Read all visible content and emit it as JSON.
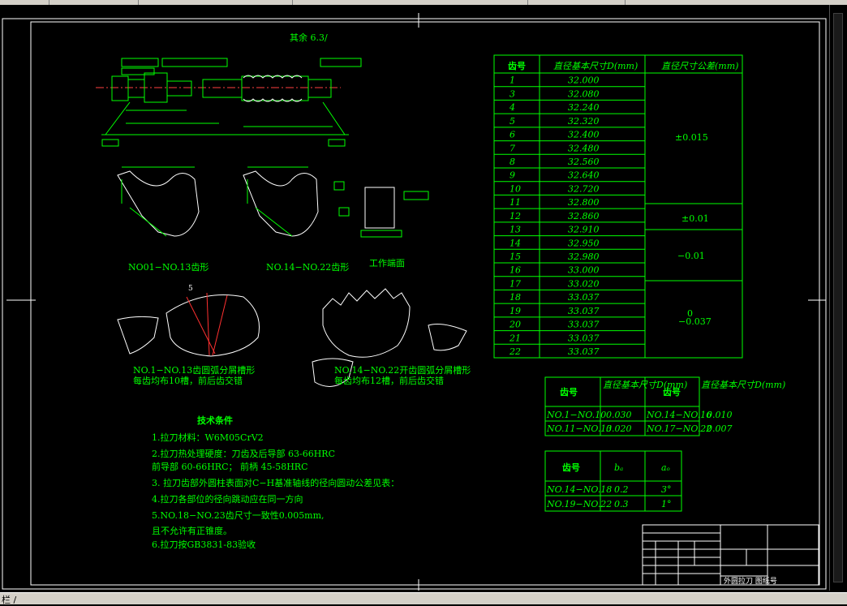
{
  "app": {
    "status_text": "栏 /"
  },
  "drawing": {
    "surface_mark": "其余 6.3/",
    "table1": {
      "headers": [
        "齿号",
        "直径基本尺寸D(mm)",
        "直径尺寸公差(mm)"
      ],
      "rows": [
        [
          "1",
          "32.000"
        ],
        [
          "3",
          "32.080"
        ],
        [
          "4",
          "32.240"
        ],
        [
          "5",
          "32.320"
        ],
        [
          "6",
          "32.400"
        ],
        [
          "7",
          "32.480"
        ],
        [
          "8",
          "32.560"
        ],
        [
          "9",
          "32.640"
        ],
        [
          "10",
          "32.720"
        ],
        [
          "11",
          "32.800"
        ],
        [
          "12",
          "32.860"
        ],
        [
          "13",
          "32.910"
        ],
        [
          "14",
          "32.950"
        ],
        [
          "15",
          "32.980"
        ],
        [
          "16",
          "33.000"
        ],
        [
          "17",
          "33.020"
        ],
        [
          "18",
          "33.037"
        ],
        [
          "19",
          "33.037"
        ],
        [
          "20",
          "33.037"
        ],
        [
          "21",
          "33.037"
        ],
        [
          "22",
          "33.037"
        ]
      ],
      "tolerances": [
        "±0.015",
        "±0.01",
        "−0.01",
        "0",
        "−0.037"
      ]
    },
    "table2": {
      "headers": [
        "齿号",
        "直径基本尺寸D(mm)",
        "齿号",
        "直径基本尺寸D(mm)"
      ],
      "rows": [
        [
          "NO.1−NO.10",
          "0.030",
          "NO.14−NO.16",
          "0.010"
        ],
        [
          "NO.11−NO.13",
          "0.020",
          "NO.17−NO.22",
          "0.007"
        ]
      ]
    },
    "table3": {
      "headers": [
        "齿号",
        "bₐ",
        "aₒ"
      ],
      "rows": [
        [
          "NO.14−NO.18",
          "0.2",
          "3°"
        ],
        [
          "NO.19−NO.22",
          "0.3",
          "1°"
        ]
      ]
    },
    "captions": {
      "profile1": "NO01−NO.13齿形",
      "profile2": "NO.14−NO.22齿形",
      "work_section": "工作端面",
      "chipbreak1_line1": "NO.1−NO.13齿圆弧分屑槽形",
      "chipbreak1_line2": "每齿均布10槽，前后齿交错",
      "chipbreak2_line1": "NO.14−NO.22开齿圆弧分屑槽形",
      "chipbreak2_line2": "每齿均布12槽，前后齿交错"
    },
    "tech": {
      "title": "技术条件",
      "lines": [
        "1.拉刀材料：W6M05CrV2",
        "2.拉刀热处理硬度：刀齿及后导部  63-66HRC",
        "   前导部  60-66HRC；  前柄  45-58HRC",
        "3.  拉刀齿部外圆柱表面对C−H基准轴线的径向圆动公差见表：",
        "4.拉刀各部位的径向跳动应在同一方向",
        "5.NO.18−NO.23齿尺寸一致性0.005mm,",
        "且不允许有正锥度。",
        "6.拉刀按GB3831-83验收"
      ]
    },
    "titleblock": {
      "drawing_name": "外圆拉刀 图纸号"
    }
  }
}
